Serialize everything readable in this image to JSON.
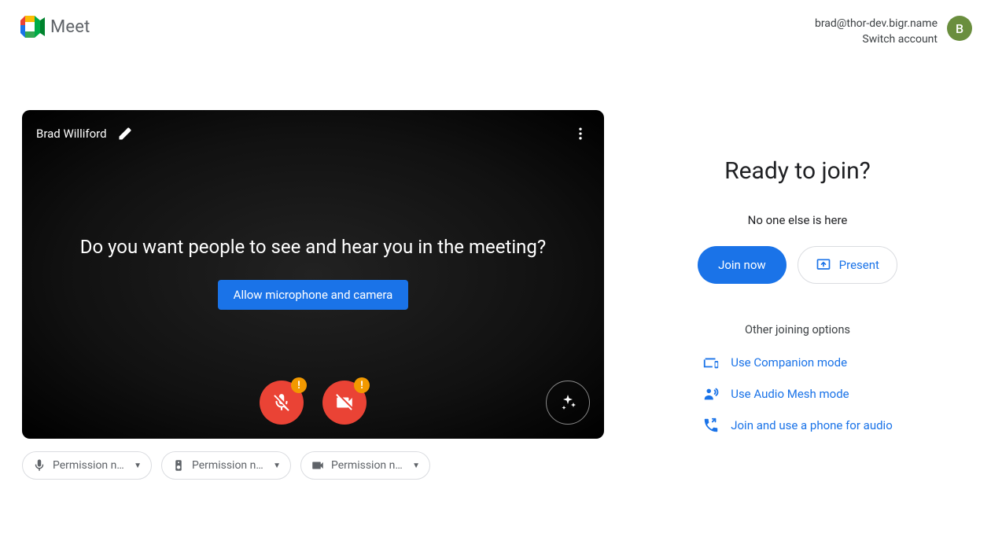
{
  "brand": {
    "name": "Meet"
  },
  "account": {
    "email": "brad@thor-dev.bigr.name",
    "switch_label": "Switch account",
    "avatar_initial": "B"
  },
  "preview": {
    "user_name": "Brad Williford",
    "prompt": "Do you want people to see and hear you in the meeting?",
    "allow_label": "Allow microphone and camera",
    "alert_badge": "!"
  },
  "selectors": {
    "mic": "Permission ne…",
    "speaker": "Permission ne…",
    "camera": "Permission ne…"
  },
  "right": {
    "heading": "Ready to join?",
    "subtitle": "No one else is here",
    "join_label": "Join now",
    "present_label": "Present",
    "other_title": "Other joining options",
    "options": {
      "companion": "Use Companion mode",
      "audio_mesh": "Use Audio Mesh mode",
      "phone": "Join and use a phone for audio"
    }
  }
}
